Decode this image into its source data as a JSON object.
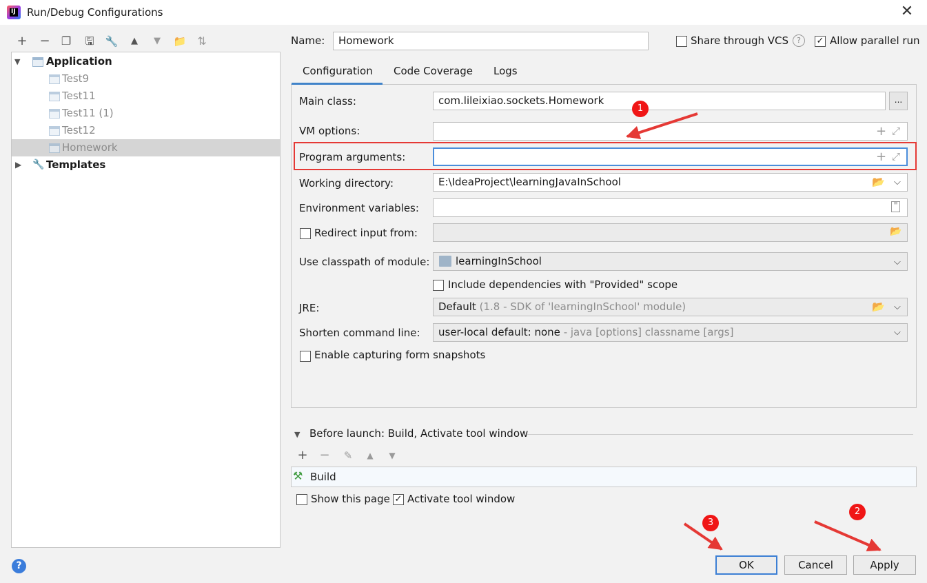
{
  "window": {
    "title": "Run/Debug Configurations",
    "close_glyph": "✕",
    "app_icon_text": "IJ"
  },
  "toolbar": [
    {
      "icon": "plus-icon",
      "glyph": "+"
    },
    {
      "icon": "minus-icon",
      "glyph": "−"
    },
    {
      "icon": "copy-icon",
      "glyph": "❐"
    },
    {
      "icon": "save-icon",
      "glyph": "🖫"
    },
    {
      "icon": "wrench-icon",
      "glyph": "🔧"
    },
    {
      "icon": "move-up-icon",
      "glyph": "▲"
    },
    {
      "icon": "move-down-icon",
      "glyph": "▼"
    },
    {
      "icon": "new-folder-icon",
      "glyph": "📁"
    },
    {
      "icon": "sort-az-icon",
      "glyph": "⇅"
    }
  ],
  "tree": {
    "application": "Application",
    "items": [
      "Test9",
      "Test11",
      "Test11 (1)",
      "Test12",
      "Homework"
    ],
    "selected": "Homework",
    "templates": "Templates"
  },
  "header": {
    "name_label": "Name:",
    "name_value": "Homework",
    "share_label": "Share through VCS",
    "share_checked": false,
    "help_glyph": "?",
    "parallel_label": "Allow parallel run",
    "parallel_checked": true
  },
  "tabs": [
    "Configuration",
    "Code Coverage",
    "Logs"
  ],
  "active_tab": "Configuration",
  "form": {
    "main_class_label": "Main class:",
    "main_class_value": "com.lileixiao.sockets.Homework",
    "browse_label": "...",
    "vm_options_label": "VM options:",
    "vm_options_value": "",
    "program_args_label": "Program arguments:",
    "program_args_value": "",
    "working_dir_label": "Working directory:",
    "working_dir_value": "E:\\IdeaProject\\learningJavaInSchool",
    "env_vars_label": "Environment variables:",
    "env_vars_value": "",
    "redirect_label": "Redirect input from:",
    "redirect_checked": false,
    "classpath_label": "Use classpath of module:",
    "classpath_value": "learningInSchool",
    "include_deps_label": "Include dependencies with \"Provided\" scope",
    "include_deps_checked": false,
    "jre_label": "JRE:",
    "jre_value": "Default",
    "jre_hint": "(1.8 - SDK of 'learningInSchool' module)",
    "shorten_label": "Shorten command line:",
    "shorten_value": "user-local default: none",
    "shorten_hint": "- java [options] classname [args]",
    "snapshots_label": "Enable capturing form snapshots",
    "snapshots_checked": false
  },
  "before_launch": {
    "title": "Before launch: Build, Activate tool window",
    "tasks": [
      "Build"
    ],
    "show_page_label": "Show this page",
    "show_page_checked": false,
    "activate_label": "Activate tool window",
    "activate_checked": true
  },
  "buttons": {
    "ok": "OK",
    "cancel": "Cancel",
    "apply": "Apply"
  },
  "annotations": {
    "badge1": "1",
    "badge2": "2",
    "badge3": "3",
    "color": "#e53935"
  }
}
